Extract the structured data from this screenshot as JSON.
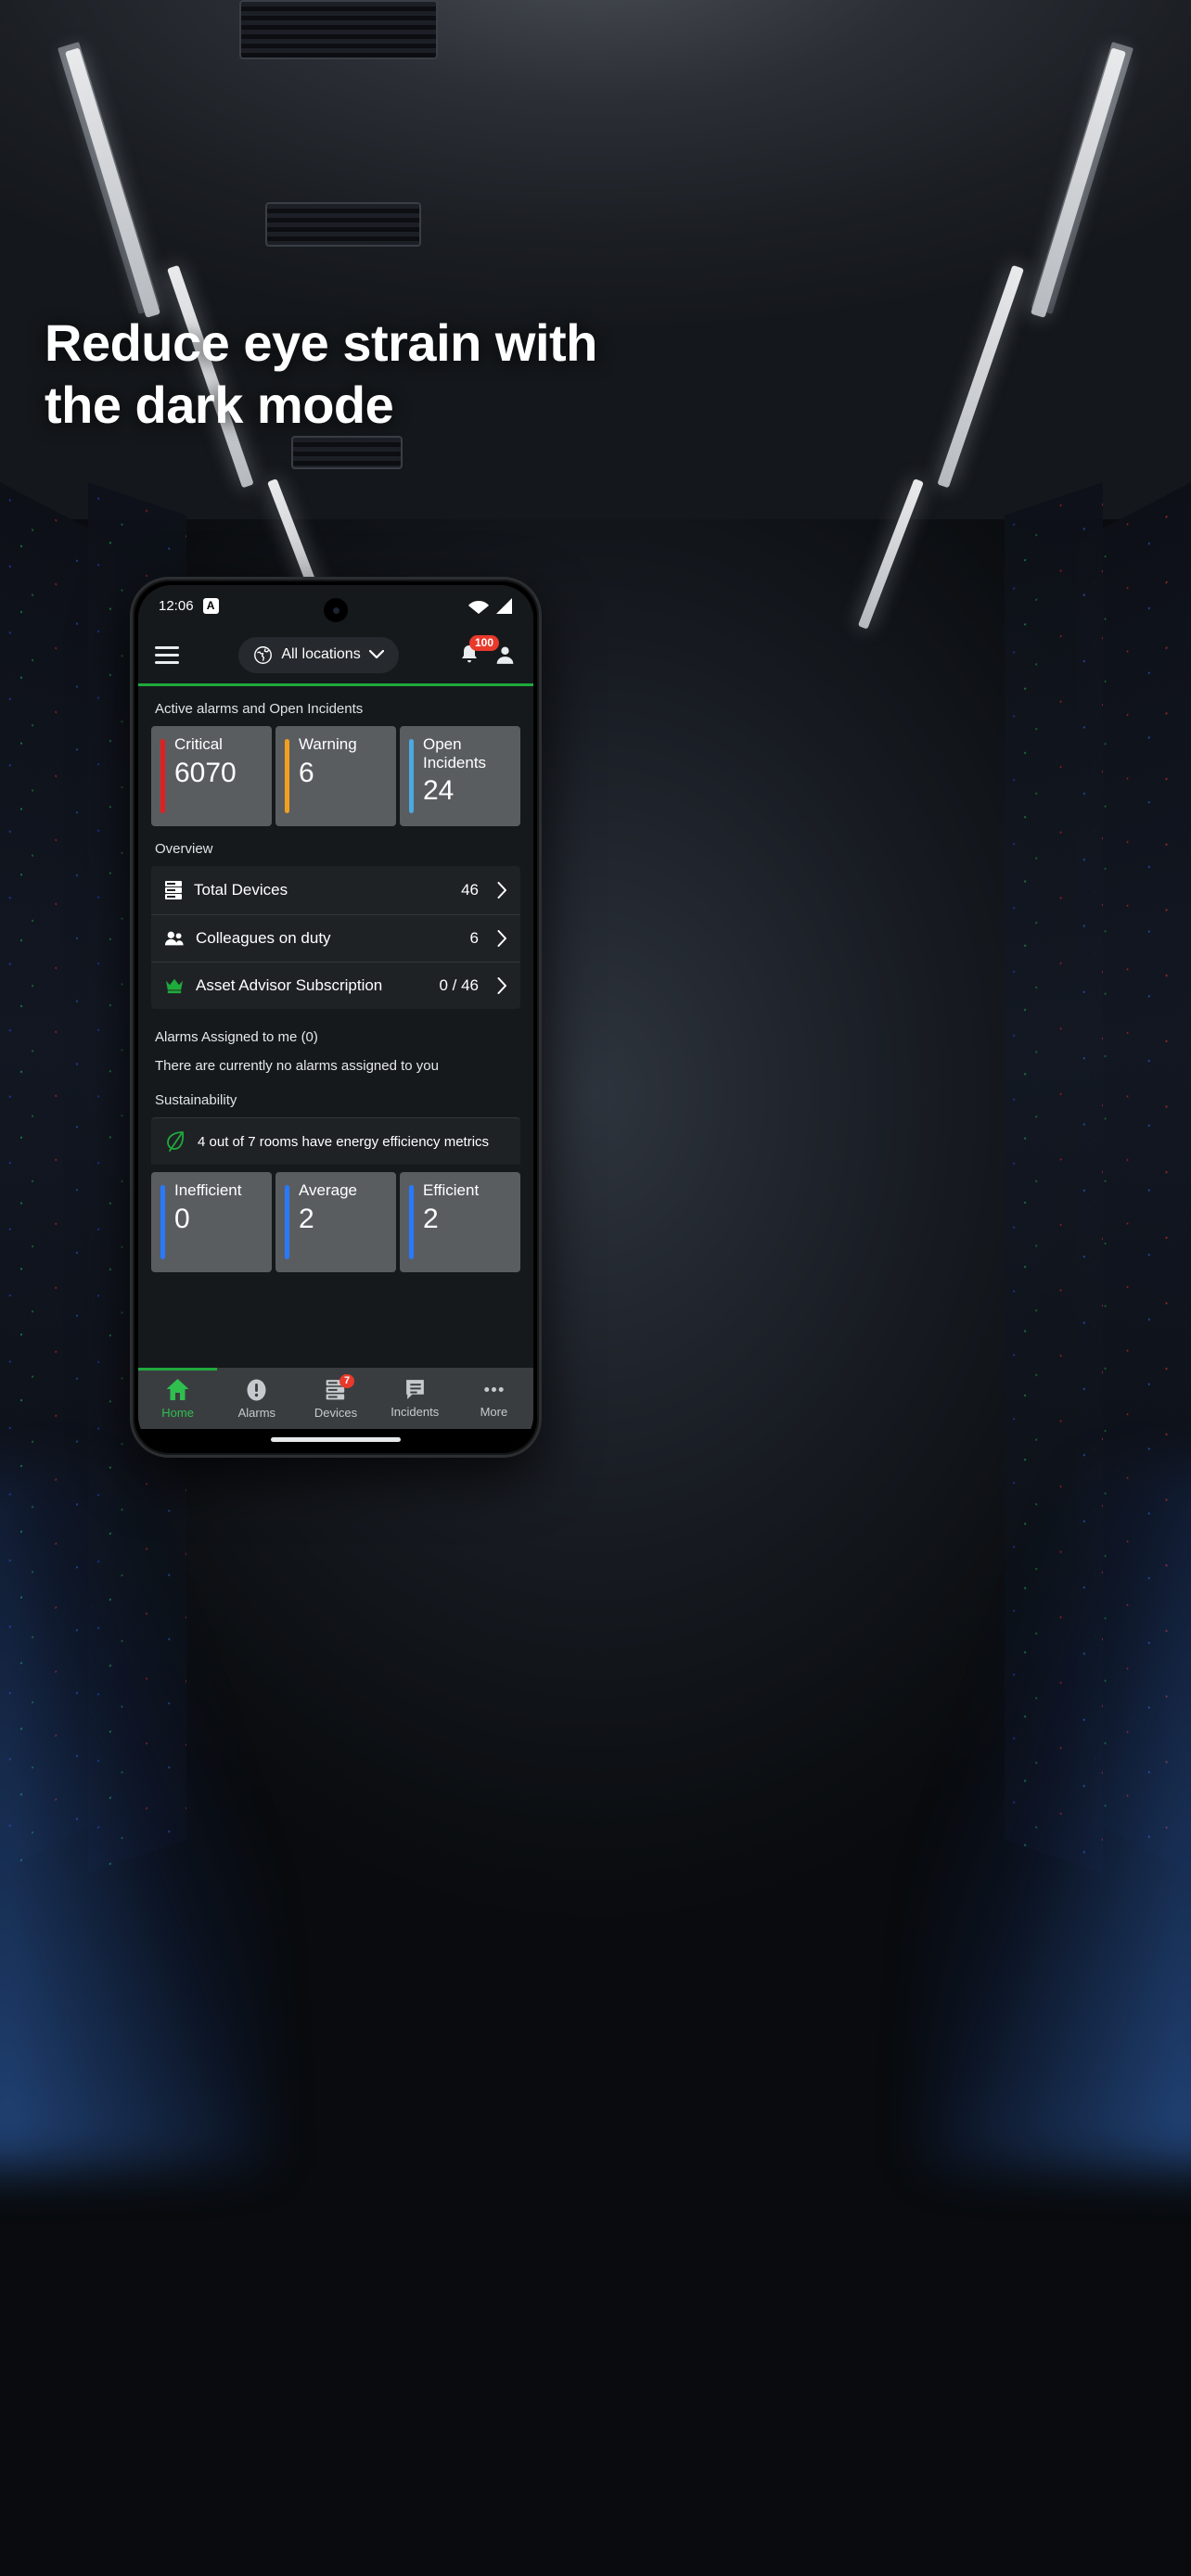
{
  "promo": {
    "headline": "Reduce eye strain with the dark mode"
  },
  "phone": {
    "status_bar": {
      "time": "12:06",
      "app_badge": "A",
      "wifi_icon": "wifi-icon",
      "signal_icon": "cellular-signal-icon"
    },
    "header": {
      "menu_icon": "hamburger-menu-icon",
      "location_icon": "globe-icon",
      "location_label": "All locations",
      "chevron_icon": "chevron-down-icon",
      "bell_icon": "notification-bell-icon",
      "bell_badge": "100",
      "profile_icon": "user-profile-icon"
    },
    "alarms_section": {
      "title": "Active alarms and Open Incidents",
      "cards": [
        {
          "label": "Critical",
          "value": "6070",
          "color": "#e02020"
        },
        {
          "label": "Warning",
          "value": "6",
          "color": "#f0a020"
        },
        {
          "label": "Open Incidents",
          "value": "24",
          "color": "#4aa9e0"
        }
      ]
    },
    "overview": {
      "title": "Overview",
      "rows": [
        {
          "icon": "server-rack-icon",
          "label": "Total Devices",
          "value": "46",
          "chevron": "chevron-right-icon"
        },
        {
          "icon": "people-icon",
          "label": "Colleagues on duty",
          "value": "6",
          "chevron": "chevron-right-icon"
        },
        {
          "icon": "crown-icon",
          "label": "Asset Advisor Subscription",
          "value": "0 / 46",
          "chevron": "chevron-right-icon"
        }
      ]
    },
    "assigned": {
      "title": "Alarms Assigned to me (0)",
      "empty_text": "There are currently no alarms assigned to you"
    },
    "sustainability": {
      "title": "Sustainability",
      "leaf_icon": "leaf-icon",
      "summary": "4 out of 7 rooms have energy efficiency metrics",
      "cards": [
        {
          "label": "Inefficient",
          "value": "0",
          "color": "#2979ff"
        },
        {
          "label": "Average",
          "value": "2",
          "color": "#2979ff"
        },
        {
          "label": "Efficient",
          "value": "2",
          "color": "#2979ff"
        }
      ]
    },
    "bottom_nav": {
      "items": [
        {
          "icon": "home-icon",
          "label": "Home",
          "badge": "",
          "active": true
        },
        {
          "icon": "alarm-exclamation-icon",
          "label": "Alarms",
          "badge": "",
          "active": false
        },
        {
          "icon": "devices-rack-icon",
          "label": "Devices",
          "badge": "7",
          "active": false
        },
        {
          "icon": "incidents-message-icon",
          "label": "Incidents",
          "badge": "",
          "active": false
        },
        {
          "icon": "more-dots-icon",
          "label": "More",
          "badge": "",
          "active": false
        }
      ]
    }
  },
  "colors": {
    "accent_green": "#1faa3c",
    "badge_red": "#e8392b",
    "card_bg": "#5a5d60",
    "screen_bg": "#16191c"
  }
}
